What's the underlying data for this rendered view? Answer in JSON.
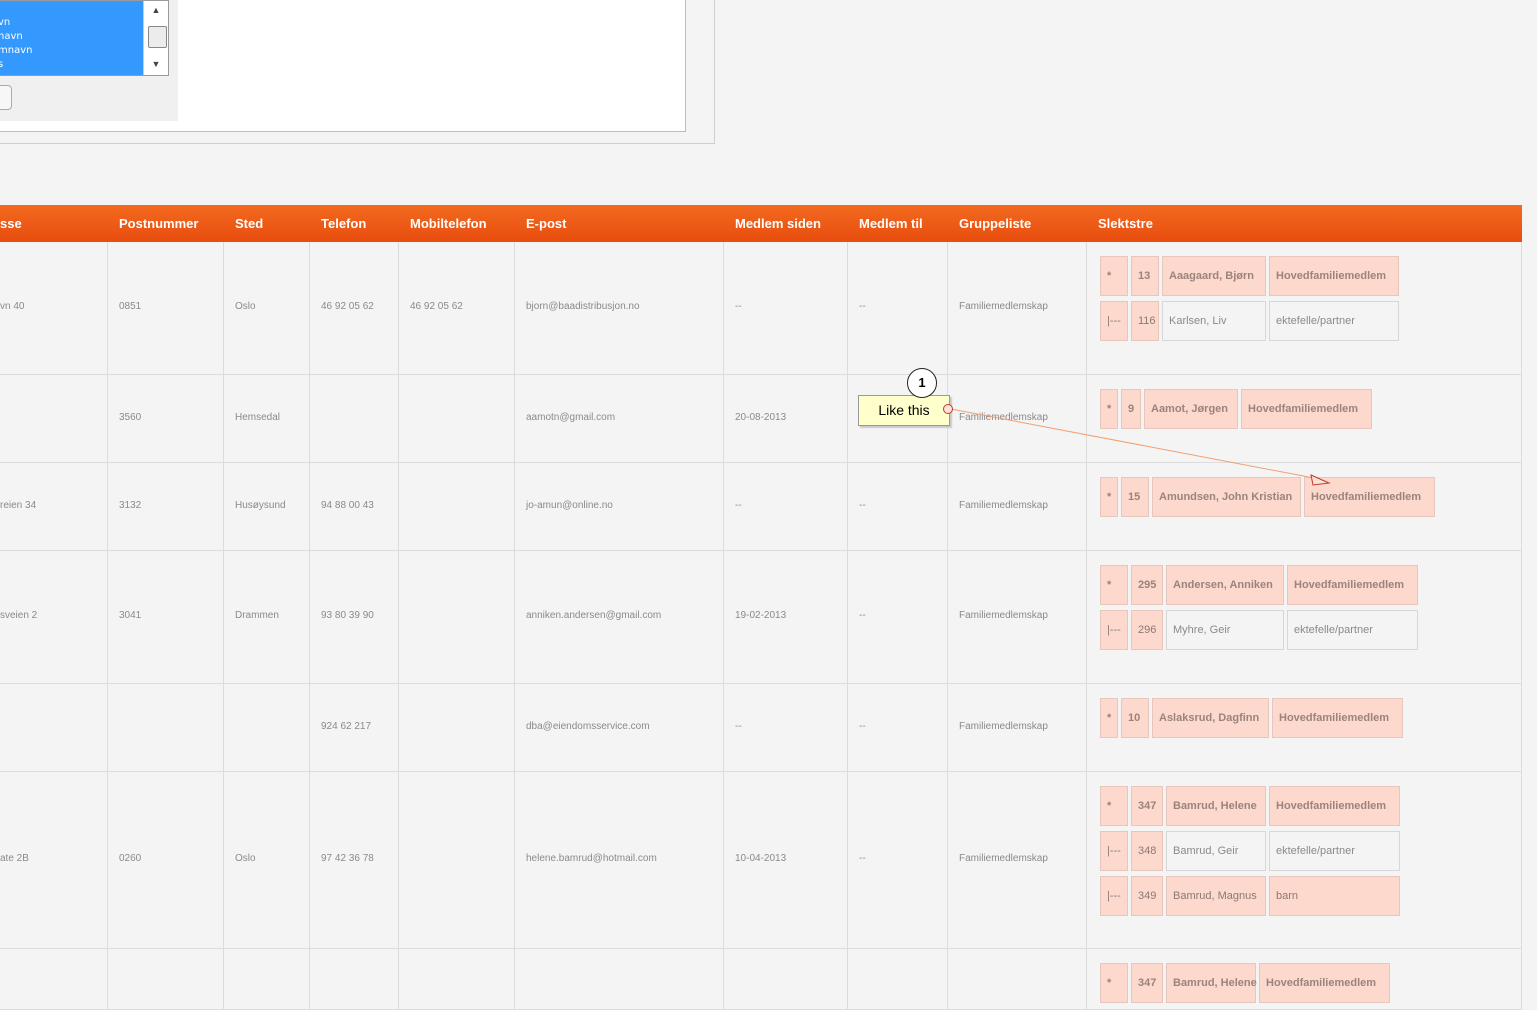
{
  "top_panel": {
    "list_options": [
      "vn",
      "navn",
      "mnavn",
      "s"
    ],
    "scroll_up": "▲",
    "scroll_down": "▼"
  },
  "table": {
    "headers": [
      "sse",
      "Postnummer",
      "Sted",
      "Telefon",
      "Mobiltelefon",
      "E-post",
      "Medlem siden",
      "Medlem til",
      "Gruppeliste",
      "Slektstre"
    ],
    "rows": [
      {
        "adresse": "vn 40",
        "postnummer": "0851",
        "sted": "Oslo",
        "telefon": "46 92 05 62",
        "mobil": "46 92 05 62",
        "epost": "bjorn@baadistribusjon.no",
        "siden": "--",
        "til": "--",
        "gruppe": "Familiemedlemskap",
        "slekt": [
          [
            "*",
            "13",
            "Aaagaard, Bjørn",
            "Hovedfamiliemedlem"
          ],
          [
            "|---",
            "116",
            "Karlsen, Liv",
            "ektefelle/partner"
          ]
        ]
      },
      {
        "adresse": "",
        "postnummer": "3560",
        "sted": "Hemsedal",
        "telefon": "",
        "mobil": "",
        "epost": "aamotn@gmail.com",
        "siden": "20-08-2013",
        "til": "",
        "gruppe": "Familiemedlemskap",
        "slekt": [
          [
            "*",
            "9",
            "Aamot, Jørgen",
            "Hovedfamiliemedlem"
          ]
        ]
      },
      {
        "adresse": "reien 34",
        "postnummer": "3132",
        "sted": "Husøysund",
        "telefon": "94 88 00 43",
        "mobil": "",
        "epost": "jo-amun@online.no",
        "siden": "--",
        "til": "--",
        "gruppe": "Familiemedlemskap",
        "slekt": [
          [
            "*",
            "15",
            "Amundsen, John Kristian",
            "Hovedfamiliemedlem"
          ]
        ]
      },
      {
        "adresse": "sveien 2",
        "postnummer": "3041",
        "sted": "Drammen",
        "telefon": "93 80 39 90",
        "mobil": "",
        "epost": "anniken.andersen@gmail.com",
        "siden": "19-02-2013",
        "til": "--",
        "gruppe": "Familiemedlemskap",
        "slekt": [
          [
            "*",
            "295",
            "Andersen, Anniken",
            "Hovedfamiliemedlem"
          ],
          [
            "|---",
            "296",
            "Myhre, Geir",
            "ektefelle/partner"
          ]
        ]
      },
      {
        "adresse": "",
        "postnummer": "",
        "sted": "",
        "telefon": "924 62 217",
        "mobil": "",
        "epost": "dba@eiendomsservice.com",
        "siden": "--",
        "til": "--",
        "gruppe": "Familiemedlemskap",
        "slekt": [
          [
            "*",
            "10",
            "Aslaksrud, Dagfinn",
            "Hovedfamiliemedlem"
          ]
        ]
      },
      {
        "adresse": "ate 2B",
        "postnummer": "0260",
        "sted": "Oslo",
        "telefon": "97 42 36 78",
        "mobil": "",
        "epost": "helene.bamrud@hotmail.com",
        "siden": "10-04-2013",
        "til": "--",
        "gruppe": "Familiemedlemskap",
        "slekt": [
          [
            "*",
            "347",
            "Bamrud, Helene",
            "Hovedfamiliemedlem"
          ],
          [
            "|---",
            "348",
            "Bamrud, Geir",
            "ektefelle/partner"
          ],
          [
            "|---",
            "349",
            "Bamrud, Magnus",
            "barn"
          ]
        ]
      },
      {
        "adresse": "",
        "postnummer": "",
        "sted": "",
        "telefon": "",
        "mobil": "",
        "epost": "",
        "siden": "",
        "til": "",
        "gruppe": "",
        "slekt": [
          [
            "*",
            "347",
            "Bamrud, Helene",
            "Hovedfamiliemedlem"
          ]
        ]
      }
    ]
  },
  "annotation": {
    "number": "1",
    "text": "Like this"
  },
  "colors": {
    "header": "#e8500f",
    "relation_highlight": "#fdd8cc",
    "listbox_selected": "#3399ff"
  }
}
